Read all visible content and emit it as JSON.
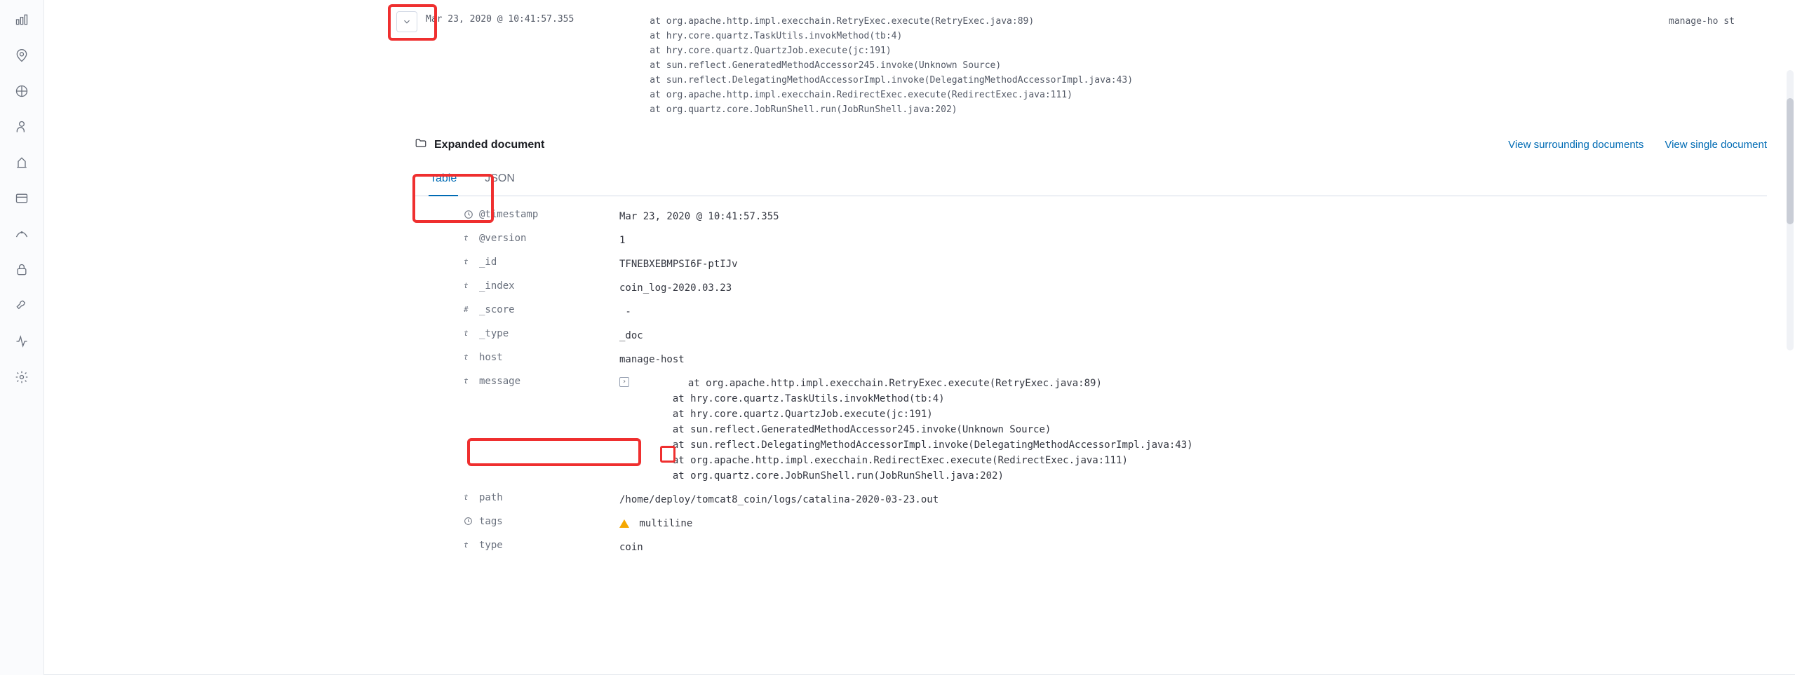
{
  "row": {
    "timestamp": "Mar 23, 2020 @ 10:41:57.355",
    "message": "    at org.apache.http.impl.execchain.RetryExec.execute(RetryExec.java:89)\n    at hry.core.quartz.TaskUtils.invokMethod(tb:4)\n    at hry.core.quartz.QuartzJob.execute(jc:191)\n    at sun.reflect.GeneratedMethodAccessor245.invoke(Unknown Source)\n    at sun.reflect.DelegatingMethodAccessorImpl.invoke(DelegatingMethodAccessorImpl.java:43)\n    at org.apache.http.impl.execchain.RedirectExec.execute(RedirectExec.java:111)\n    at org.quartz.core.JobRunShell.run(JobRunShell.java:202)",
    "host": "manage-ho\nst"
  },
  "expanded": {
    "title": "Expanded document",
    "link_surrounding": "View surrounding documents",
    "link_single": "View single document",
    "tabs": {
      "table": "Table",
      "json": "JSON"
    }
  },
  "fields": {
    "timestamp": {
      "name": "@timestamp",
      "value": "Mar 23, 2020 @ 10:41:57.355"
    },
    "version": {
      "name": "@version",
      "value": "1"
    },
    "id": {
      "name": "_id",
      "value": "TFNEBXEBMPSI6F-ptIJv"
    },
    "index": {
      "name": "_index",
      "value": "coin_log-2020.03.23"
    },
    "score": {
      "name": "_score",
      "value": " -"
    },
    "type_": {
      "name": "_type",
      "value": "_doc"
    },
    "host": {
      "name": "host",
      "value": "manage-host"
    },
    "message": {
      "name": "message",
      "value": "         at org.apache.http.impl.execchain.RetryExec.execute(RetryExec.java:89)\n         at hry.core.quartz.TaskUtils.invokMethod(tb:4)\n         at hry.core.quartz.QuartzJob.execute(jc:191)\n         at sun.reflect.GeneratedMethodAccessor245.invoke(Unknown Source)\n         at sun.reflect.DelegatingMethodAccessorImpl.invoke(DelegatingMethodAccessorImpl.java:43)\n         at org.apache.http.impl.execchain.RedirectExec.execute(RedirectExec.java:111)\n         at org.quartz.core.JobRunShell.run(JobRunShell.java:202)"
    },
    "path": {
      "name": "path",
      "value": "/home/deploy/tomcat8_coin/logs/catalina-2020-03-23.out"
    },
    "tags": {
      "name": "tags",
      "value": " multiline"
    },
    "type": {
      "name": "type",
      "value": "coin"
    }
  },
  "icons": {
    "t": "t",
    "hash": "#",
    "clock": "🕘",
    "folder": "folder"
  }
}
